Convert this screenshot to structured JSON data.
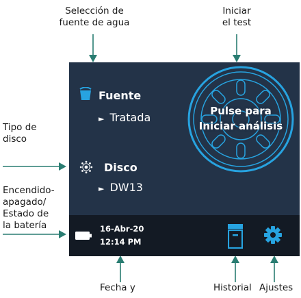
{
  "callouts": {
    "water_source": [
      "Selección de",
      "fuente de agua"
    ],
    "start_test": [
      "Iniciar",
      "el test"
    ],
    "disc_type": [
      "Tipo de",
      "disco"
    ],
    "power": [
      "Encendido-",
      "apagado/",
      "Estado de",
      "la batería"
    ],
    "date": "Fecha y",
    "history": "Historial",
    "settings": "Ajustes"
  },
  "screen": {
    "source": {
      "label": "Fuente",
      "value": "Tratada",
      "icon": "bucket-icon"
    },
    "disc": {
      "label": "Disco",
      "value": "DW13",
      "icon": "disc-icon"
    },
    "start_button": {
      "line1": "Pulse para",
      "line2": "Iniciar análisis"
    },
    "date": "16-Abr-20",
    "time": "12:14 PM",
    "battery_icon": "battery-icon",
    "history_icon": "archive-icon",
    "settings_icon": "gear-icon",
    "arrow_glyph": "►"
  },
  "colors": {
    "screen_bg": "#233348",
    "status_bar_bg": "#131a24",
    "accent": "#27a3e0",
    "arrow": "#2a7d72",
    "text": "#ffffff"
  }
}
